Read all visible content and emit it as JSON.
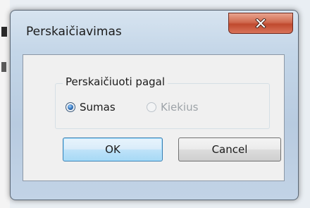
{
  "window": {
    "title": "Perskaičiavimas",
    "close_icon": "close-x-icon"
  },
  "group": {
    "label": "Perskaičiuoti pagal",
    "options": [
      {
        "label": "Sumas",
        "selected": true,
        "enabled": true
      },
      {
        "label": "Kiekius",
        "selected": false,
        "enabled": false
      }
    ]
  },
  "buttons": {
    "ok_label": "OK",
    "cancel_label": "Cancel"
  },
  "colors": {
    "close_button": "#c9583e",
    "default_button_border": "#3c7fb1",
    "frame": "#c4d6e8"
  }
}
